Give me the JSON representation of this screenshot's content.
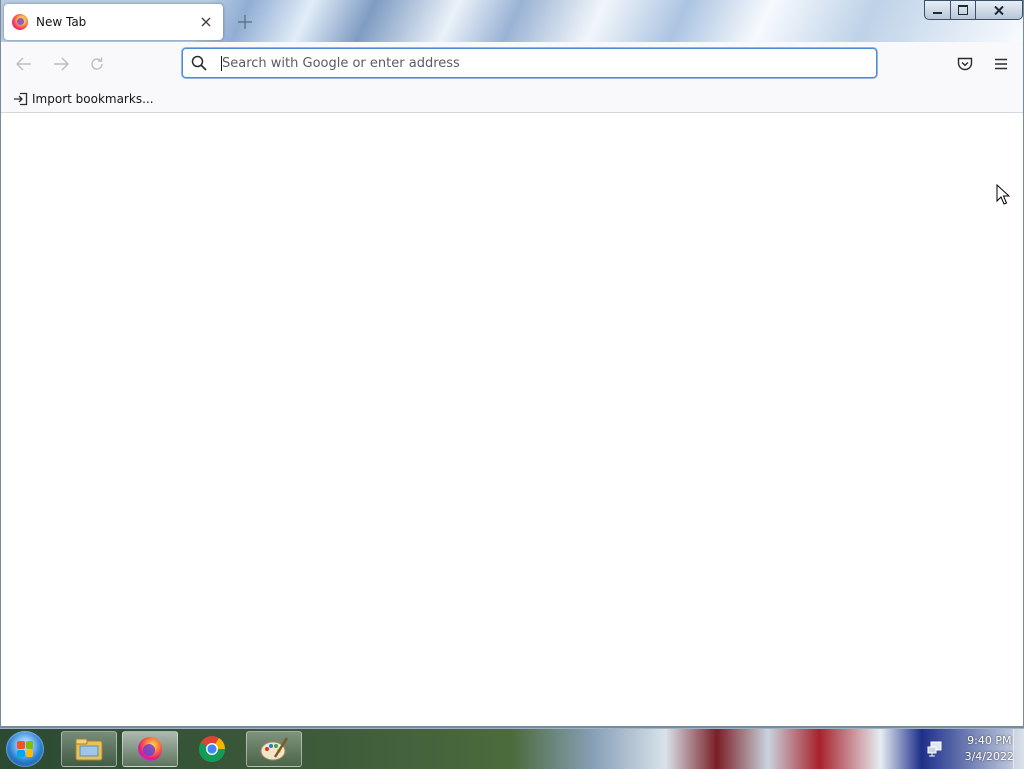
{
  "browser": {
    "tab": {
      "title": "New Tab",
      "favicon": "firefox-icon",
      "close_icon": "close-icon"
    },
    "new_tab_icon": "plus-icon",
    "window_controls": [
      "minimize",
      "restore",
      "close"
    ],
    "navbar": {
      "back_icon": "arrow-left-icon",
      "forward_icon": "arrow-right-icon",
      "reload_icon": "reload-icon",
      "search_icon": "search-icon",
      "address_placeholder": "Search with Google or enter address",
      "address_value": "",
      "pocket_icon": "pocket-icon",
      "menu_icon": "hamburger-menu-icon"
    },
    "bookmarks_toolbar": {
      "import_label": "Import bookmarks...",
      "import_icon": "import-icon"
    },
    "accent_color": "#4d8cd6"
  },
  "taskbar": {
    "start_button": "windows-start-orb",
    "pinned": [
      {
        "name": "file-explorer",
        "icon": "folder-icon"
      },
      {
        "name": "firefox",
        "icon": "firefox-icon",
        "active": true
      },
      {
        "name": "chrome",
        "icon": "chrome-icon"
      },
      {
        "name": "paint",
        "icon": "paint-palette-icon"
      }
    ],
    "tray": {
      "network_icon": "network-icon",
      "time": "9:40 PM",
      "date": "3/4/2022"
    }
  }
}
